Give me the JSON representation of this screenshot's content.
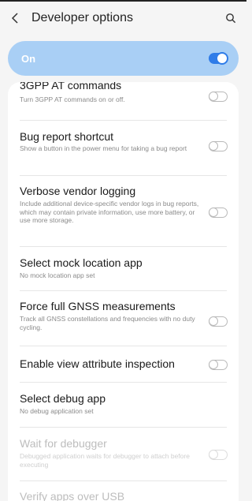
{
  "header": {
    "title": "Developer options",
    "back_icon": "chevron-left-icon",
    "search_icon": "search-icon"
  },
  "master_switch": {
    "label": "On",
    "state": "on",
    "accent": "#2f7ce8"
  },
  "items": [
    {
      "title": "3GPP AT commands",
      "summary": "Turn 3GPP AT commands on or off.",
      "switch": "off"
    },
    {
      "title": "Bug report shortcut",
      "summary": "Show a button in the power menu for taking a bug report",
      "switch": "off"
    },
    {
      "title": "Verbose vendor logging",
      "summary": "Include additional device-specific vendor logs in bug reports, which may contain private information, use more battery, or use more storage.",
      "switch": "off"
    },
    {
      "title": "Select mock location app",
      "summary": "No mock location app set"
    },
    {
      "title": "Force full GNSS measurements",
      "summary": "Track all GNSS constellations and frequencies with no duty cycling.",
      "switch": "off"
    },
    {
      "title": "Enable view attribute inspection",
      "summary": "",
      "switch": "off"
    },
    {
      "title": "Select debug app",
      "summary": "No debug application set"
    },
    {
      "title": "Wait for debugger",
      "summary": "Debugged application waits for debugger to attach before executing",
      "switch": "off",
      "disabled": true
    },
    {
      "title": "Verify apps over USB",
      "summary": ""
    }
  ]
}
